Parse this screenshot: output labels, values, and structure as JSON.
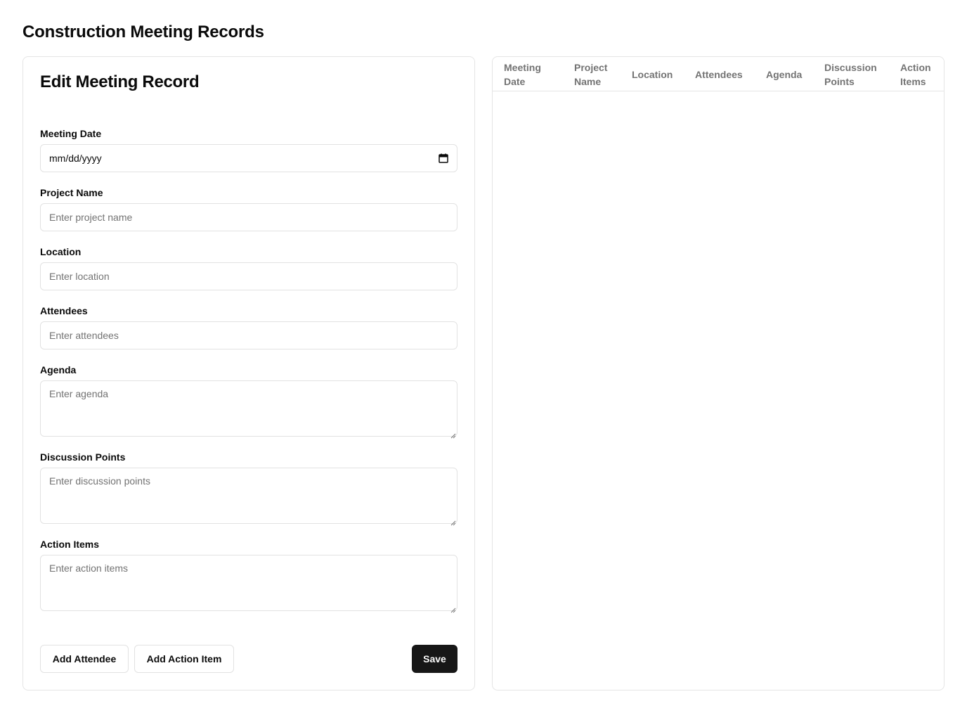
{
  "page": {
    "title": "Construction Meeting Records"
  },
  "form": {
    "title": "Edit Meeting Record",
    "meeting_date": {
      "label": "Meeting Date",
      "value": "mm/dd/yyyy"
    },
    "project_name": {
      "label": "Project Name",
      "placeholder": "Enter project name"
    },
    "location": {
      "label": "Location",
      "placeholder": "Enter location"
    },
    "attendees": {
      "label": "Attendees",
      "placeholder": "Enter attendees"
    },
    "agenda": {
      "label": "Agenda",
      "placeholder": "Enter agenda"
    },
    "discussion_points": {
      "label": "Discussion Points",
      "placeholder": "Enter discussion points"
    },
    "action_items": {
      "label": "Action Items",
      "placeholder": "Enter action items"
    },
    "buttons": {
      "add_attendee": "Add Attendee",
      "add_action_item": "Add Action Item",
      "save": "Save"
    }
  },
  "table": {
    "columns": [
      {
        "line1": "Meeting",
        "line2": "Date"
      },
      {
        "line1": "Project",
        "line2": "Name"
      },
      {
        "line1": "Location",
        "line2": ""
      },
      {
        "line1": "Attendees",
        "line2": ""
      },
      {
        "line1": "Agenda",
        "line2": ""
      },
      {
        "line1": "Discussion",
        "line2": "Points"
      },
      {
        "line1": "Action",
        "line2": "Items"
      }
    ],
    "rows": []
  },
  "colors": {
    "primary": "#171717",
    "border": "#e5e5e5",
    "muted_text": "#737373"
  },
  "icons": {
    "calendar": "calendar-icon"
  }
}
